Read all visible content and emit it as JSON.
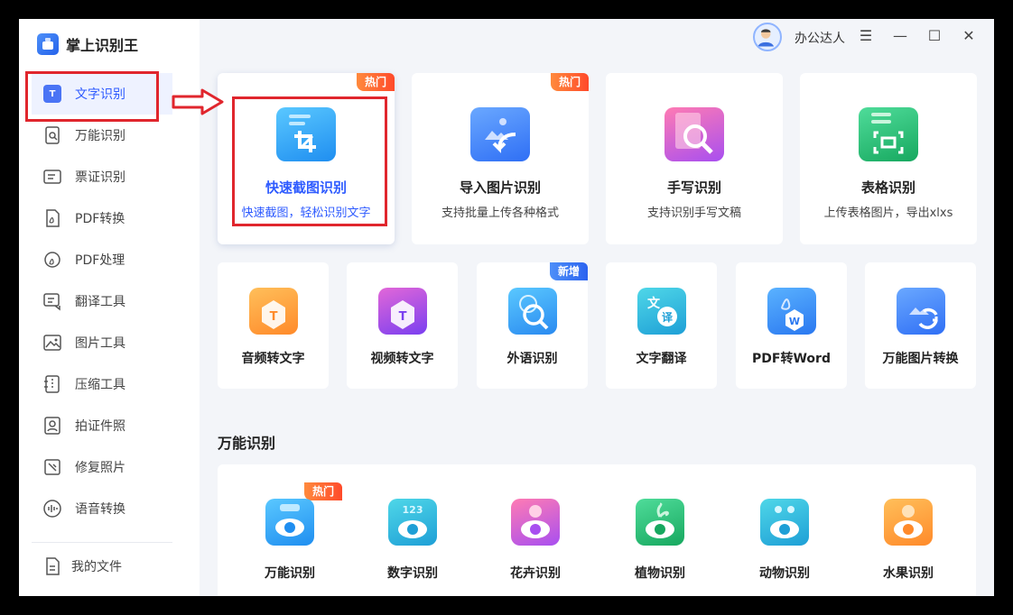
{
  "app": {
    "name": "掌上识别王",
    "user": "办公达人"
  },
  "sidebar": {
    "items": [
      {
        "label": "文字识别",
        "icon": "text-t-icon"
      },
      {
        "label": "万能识别",
        "icon": "scan-doc-icon"
      },
      {
        "label": "票证识别",
        "icon": "ticket-icon"
      },
      {
        "label": "PDF转换",
        "icon": "pdf-file-icon"
      },
      {
        "label": "PDF处理",
        "icon": "pdf-gear-icon"
      },
      {
        "label": "翻译工具",
        "icon": "translate-icon"
      },
      {
        "label": "图片工具",
        "icon": "image-icon"
      },
      {
        "label": "压缩工具",
        "icon": "compress-icon"
      },
      {
        "label": "拍证件照",
        "icon": "id-photo-icon"
      },
      {
        "label": "修复照片",
        "icon": "repair-photo-icon"
      },
      {
        "label": "语音转换",
        "icon": "voice-icon"
      }
    ],
    "my_files": "我的文件",
    "active_badge": "T"
  },
  "top_cards": [
    {
      "title": "快速截图识别",
      "sub": "快速截图，轻松识别文字",
      "tag": "热门"
    },
    {
      "title": "导入图片识别",
      "sub": "支持批量上传各种格式",
      "tag": "热门"
    },
    {
      "title": "手写识别",
      "sub": "支持识别手写文稿",
      "tag": ""
    },
    {
      "title": "表格识别",
      "sub": "上传表格图片，导出xlxs",
      "tag": ""
    }
  ],
  "tool_cards": [
    {
      "title": "音频转文字",
      "tag": ""
    },
    {
      "title": "视频转文字",
      "tag": ""
    },
    {
      "title": "外语识别",
      "tag": "新增"
    },
    {
      "title": "文字翻译",
      "tag": ""
    },
    {
      "title": "PDF转Word",
      "tag": ""
    },
    {
      "title": "万能图片转换",
      "tag": ""
    }
  ],
  "section": {
    "title": "万能识别",
    "items": [
      {
        "title": "万能识别",
        "tag": "热门"
      },
      {
        "title": "数字识别",
        "tag": ""
      },
      {
        "title": "花卉识别",
        "tag": ""
      },
      {
        "title": "植物识别",
        "tag": ""
      },
      {
        "title": "动物识别",
        "tag": ""
      },
      {
        "title": "水果识别",
        "tag": ""
      }
    ]
  },
  "icon_glyphs": {
    "audio": "T",
    "video": "T",
    "translate": "文",
    "translate_sub": "译",
    "word": "W",
    "digits": "123"
  },
  "colors": {
    "accent": "#2e5bff",
    "highlight": "#e0262d",
    "hot": "#ff5a2a",
    "new": "#2b63f0"
  }
}
